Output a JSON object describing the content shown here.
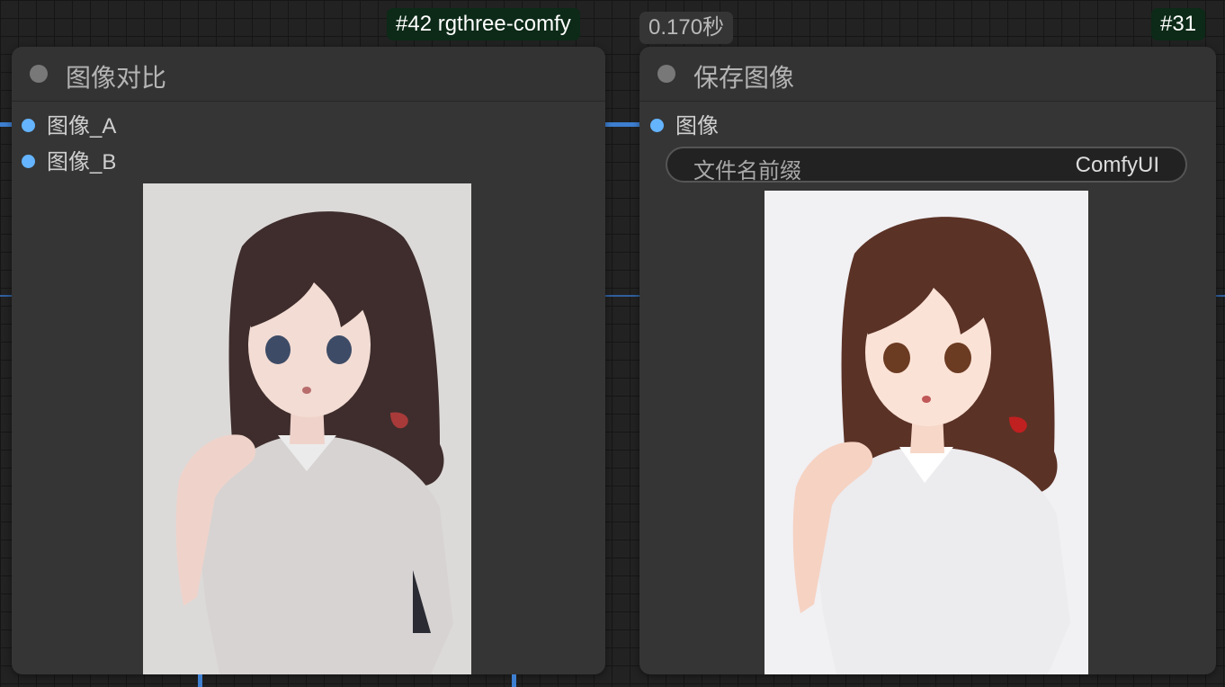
{
  "badges": {
    "left_id": "#42 rgthree-comfy",
    "time": "0.170秒",
    "right_id": "#31"
  },
  "compare_node": {
    "title": "图像对比",
    "inputs": [
      "图像_A",
      "图像_B"
    ],
    "preview_icon": "image-compare-preview"
  },
  "save_node": {
    "title": "保存图像",
    "input": "图像",
    "filename_widget": {
      "label": "文件名前缀",
      "value": "ComfyUI"
    },
    "preview_icon": "saved-image-preview"
  },
  "colors": {
    "canvas": "#222222",
    "node_body": "#353535",
    "slot_dot": "#64b4ff",
    "badge_green": "#0c2a17",
    "link": "#3d7fd0"
  }
}
